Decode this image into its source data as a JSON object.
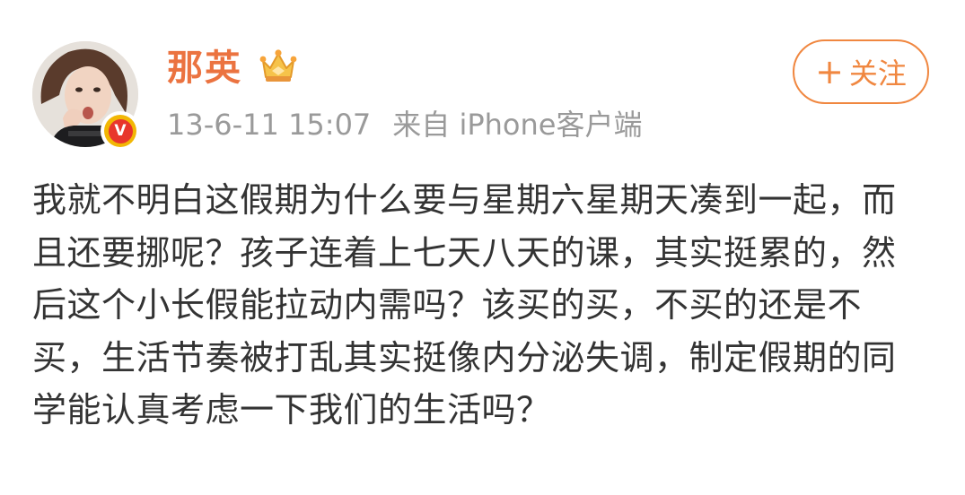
{
  "post": {
    "author": {
      "name": "那英",
      "avatar_icon": "avatar-photo",
      "verified_badge_icon": "verified-v-icon",
      "verified_badge_glyph": "V",
      "vip_icon": "vip-crown-icon"
    },
    "timestamp": "13-6-11 15:07",
    "source": "来自 iPhone客户端",
    "follow_button": {
      "icon": "plus-icon",
      "icon_glyph": "+",
      "label": "关注"
    },
    "text": "我就不明白这假期为什么要与星期六星期天凑到一起，而且还要挪呢？孩子连着上七天八天的课，其实挺累的，然后这个小长假能拉动内需吗？该买的买，不买的还是不买，生活节奏被打乱其实挺像内分泌失调，制定假期的同学能认真考虑一下我们的生活吗？"
  },
  "colors": {
    "name_orange": "#eb7340",
    "follow_orange": "#f08740",
    "meta_gray": "#9a9a9a",
    "body_text": "#333333",
    "badge_gold": "#f2b705",
    "badge_red": "#e8362c"
  }
}
